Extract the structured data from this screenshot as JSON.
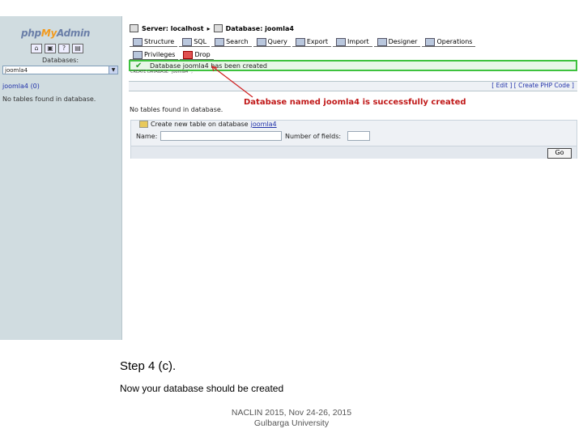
{
  "logo": {
    "php": "php",
    "my": "My",
    "admin": "Admin"
  },
  "sidebar": {
    "databases_label": "Databases:",
    "db_select_value": "joomla4",
    "db_link": "joomla4 (0)",
    "no_tables": "No tables found in database."
  },
  "breadcrumb": {
    "server": "Server: localhost",
    "database": "Database: joomla4"
  },
  "tabs": [
    "Structure",
    "SQL",
    "Search",
    "Query",
    "Export",
    "Import",
    "Designer",
    "Operations",
    "Privileges",
    "Drop"
  ],
  "message": {
    "success": "Database joomla4 has been created",
    "edit_links": "[ Edit ] [ Create PHP Code ]"
  },
  "callout": "Database named joomla4 is successfully created",
  "main_no_tables": "No tables found in database.",
  "create_table": {
    "title": "Create new table on database",
    "db": "joomla4",
    "name_label": "Name:",
    "fields_label": "Number of fields:",
    "go": "Go"
  },
  "slide": {
    "step": "Step 4 (c).",
    "text": "Now your database should be created",
    "footer1": "NACLIN 2015, Nov 24-26, 2015",
    "footer2": "Gulbarga University"
  },
  "colors": {
    "success_border": "#3ec23e",
    "callout_text": "#c01818",
    "sidebar_bg": "#d0dce0"
  }
}
